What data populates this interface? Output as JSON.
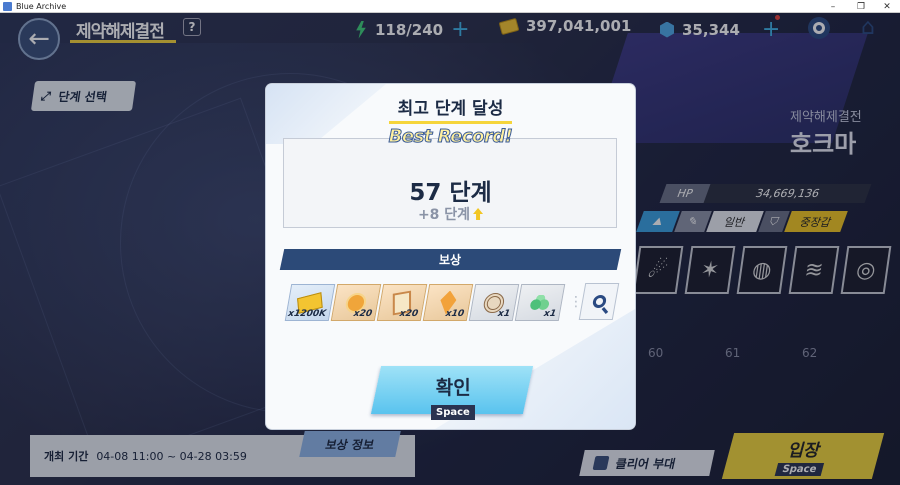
{
  "window": {
    "title": "Blue Archive",
    "controls": [
      "–",
      "❐",
      "✕"
    ]
  },
  "header": {
    "title": "제약해제결전",
    "help": "?",
    "ap": "118/240",
    "credits": "397,041,001",
    "pyroxene": "35,344"
  },
  "left": {
    "stage_select": "단계 선택"
  },
  "boss": {
    "subtitle": "제약해제결전",
    "name": "호크마",
    "hp_label": "HP",
    "hp_value": "34,669,136",
    "tag_normal": "일반",
    "tag_armor": "중장갑"
  },
  "stage_numbers": [
    "60",
    "61",
    "62"
  ],
  "bottom": {
    "period_label": "개최 기간",
    "period_value": "04-08 11:00 ~ 04-28 03:59",
    "reward_info": "보상 정보",
    "clear_team": "클리어 부대",
    "enter": "입장",
    "enter_key": "Space"
  },
  "modal": {
    "title": "최고 단계 달성",
    "best_record": "Best Record!",
    "stage": "57 단계",
    "delta": "+8 단계",
    "reward_header": "보상",
    "items": [
      {
        "icon": "credit-icon",
        "count": "x1200K"
      },
      {
        "icon": "coin-icon",
        "count": "x20"
      },
      {
        "icon": "report-icon",
        "count": "x20"
      },
      {
        "icon": "gem-shard-icon",
        "count": "x10"
      },
      {
        "icon": "target-icon",
        "count": "x1"
      },
      {
        "icon": "spheres-icon",
        "count": "x1"
      }
    ],
    "confirm": "확인",
    "confirm_key": "Space"
  },
  "colors": {
    "accent_yellow": "#f5d53b",
    "navy": "#2c4a78",
    "sky": "#59c3ee"
  }
}
